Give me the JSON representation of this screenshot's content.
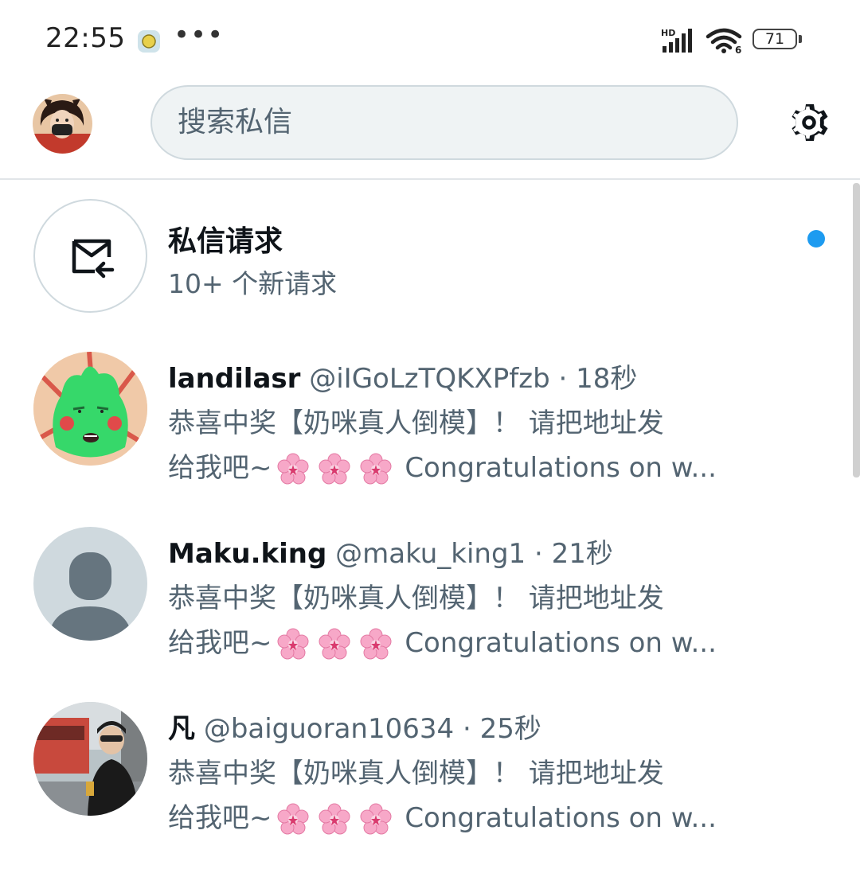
{
  "status_bar": {
    "time": "22:55",
    "dots": "•••",
    "signal_badge": "HD",
    "wifi_badge": "6",
    "battery": "71"
  },
  "header": {
    "search_placeholder": "搜索私信"
  },
  "message_requests": {
    "title": "私信请求",
    "subtitle": "10+ 个新请求",
    "unread_color": "#1d9bf0"
  },
  "conversations": [
    {
      "name": "landilasr",
      "handle": "@iIGoLzTQKXPfzb",
      "separator": " · ",
      "time": "18秒",
      "line1": "恭喜中奖【奶咪真人倒模】！ 请把地址发",
      "line2_prefix": "给我吧~",
      "line2_suffix": "Congratulations on w...",
      "emoji": "cherry-blossom-icon"
    },
    {
      "name": "Maku.king",
      "handle": "@maku_king1",
      "separator": " · ",
      "time": "21秒",
      "line1": "恭喜中奖【奶咪真人倒模】！ 请把地址发",
      "line2_prefix": "给我吧~",
      "line2_suffix": "Congratulations on w...",
      "emoji": "cherry-blossom-icon"
    },
    {
      "name": "凡",
      "handle": "@baiguoran10634",
      "separator": " · ",
      "time": "25秒",
      "line1": "恭喜中奖【奶咪真人倒模】！ 请把地址发",
      "line2_prefix": "给我吧~",
      "line2_suffix": "Congratulations on w...",
      "emoji": "cherry-blossom-icon"
    }
  ],
  "colors": {
    "accent": "#1d9bf0",
    "secondary_text": "#536471",
    "primary_text": "#0f1419",
    "border": "#cfd9de"
  }
}
